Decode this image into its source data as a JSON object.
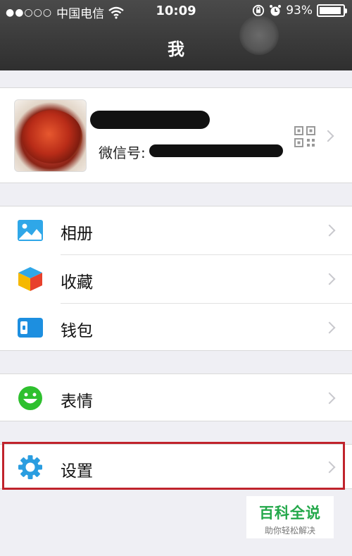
{
  "status_bar": {
    "signal": "●●○○○",
    "carrier": "中国电信",
    "time": "10:09",
    "battery_percent": "93%",
    "battery_level": 0.93
  },
  "header": {
    "title": "我"
  },
  "profile": {
    "name_visible": "",
    "wechat_id_label": "微信号:"
  },
  "menu": {
    "album": "相册",
    "favorites": "收藏",
    "wallet": "钱包",
    "stickers": "表情",
    "settings": "设置"
  },
  "watermark": {
    "title": "百科全说",
    "subtitle": "助你轻松解决"
  },
  "colors": {
    "header": "#3a3a3a",
    "highlight": "#c0232c",
    "album_icon": "#2fa7e8",
    "wallet_icon": "#1d8fe0",
    "stickers_icon": "#2ec02e",
    "settings_icon": "#2a9de0",
    "watermark_green": "#23a84a"
  }
}
